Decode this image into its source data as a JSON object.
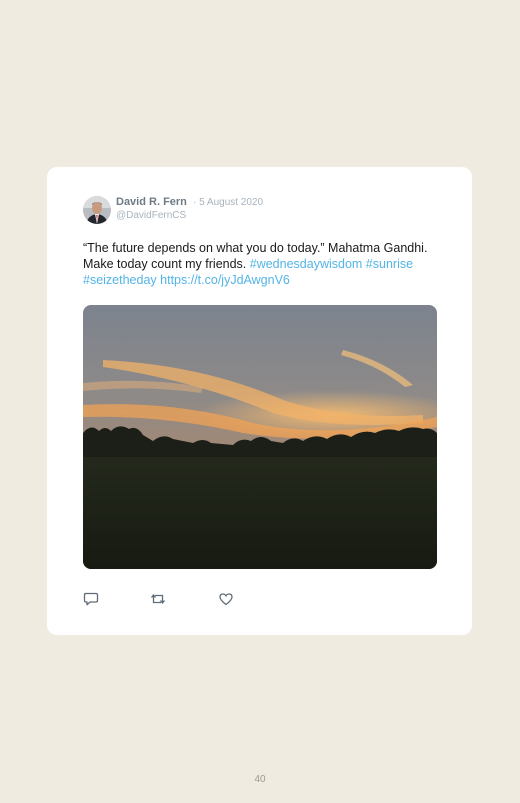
{
  "tweet": {
    "author_name": "David R. Fern",
    "date": "· 5 August 2020",
    "handle": "@DavidFernCS",
    "text": "“The future depends on what you do today.” Mahatma Gandhi. Make today count my friends. ",
    "hashtags": [
      "#wednesdaywisdom",
      "#sunrise",
      "#seizetheday"
    ],
    "link": "https://t.co/jyJdAwgnV6",
    "avatar_icon": "profile-photo",
    "photo_description_icon": "sunrise-over-field-photo"
  },
  "actions": [
    {
      "icon": "reply-icon"
    },
    {
      "icon": "retweet-icon"
    },
    {
      "icon": "like-icon"
    }
  ],
  "page": {
    "number": "40"
  },
  "colors": {
    "background": "#efebe1",
    "card": "#ffffff",
    "link": "#53b4e6",
    "muted": "#a8b3bc",
    "name": "#6e7a85"
  }
}
